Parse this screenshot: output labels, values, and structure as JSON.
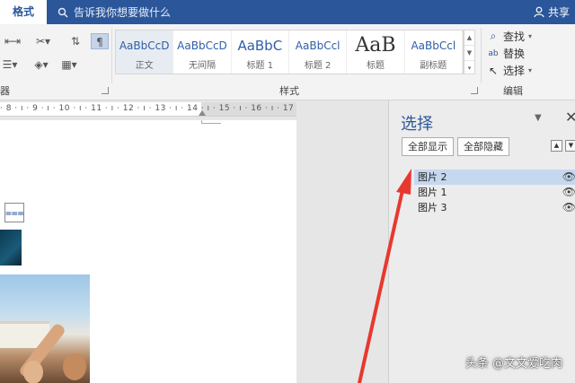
{
  "titlebar": {
    "active_tab": "格式",
    "tell_me": "告诉我你想要做什么",
    "share": "共享"
  },
  "ribbon": {
    "left_group_label": "器",
    "styles_group_label": "样式",
    "styles": [
      {
        "sample": "AaBbCcD",
        "name": "正文"
      },
      {
        "sample": "AaBbCcD",
        "name": "无间隔"
      },
      {
        "sample": "AaBbC",
        "name": "标题 1"
      },
      {
        "sample": "AaBbCcl",
        "name": "标题 2"
      },
      {
        "sample": "AaB",
        "name": "标题"
      },
      {
        "sample": "AaBbCcl",
        "name": "副标题"
      }
    ],
    "editing_group_label": "编辑",
    "editing": {
      "find": "查找",
      "replace": "替换",
      "select": "选择"
    }
  },
  "document": {
    "ruler_text": "· 8 · ı · 9 · ı · 10 · ı · 11 · ı · 12 · ı · 13 · ı · 14 · ı · 15 · ı · 16 · ı · 17 · ı · 18"
  },
  "selection_pane": {
    "title": "选择",
    "show_all": "全部显示",
    "hide_all": "全部隐藏",
    "items": [
      {
        "label": "图片 2",
        "selected": true
      },
      {
        "label": "图片 1",
        "selected": false
      },
      {
        "label": "图片 3",
        "selected": false
      }
    ]
  },
  "watermark": "头条 @文文爱吃肉",
  "colors": {
    "accent": "#2b579a",
    "selection": "#c6d8ef",
    "arrow": "#e8382e"
  }
}
